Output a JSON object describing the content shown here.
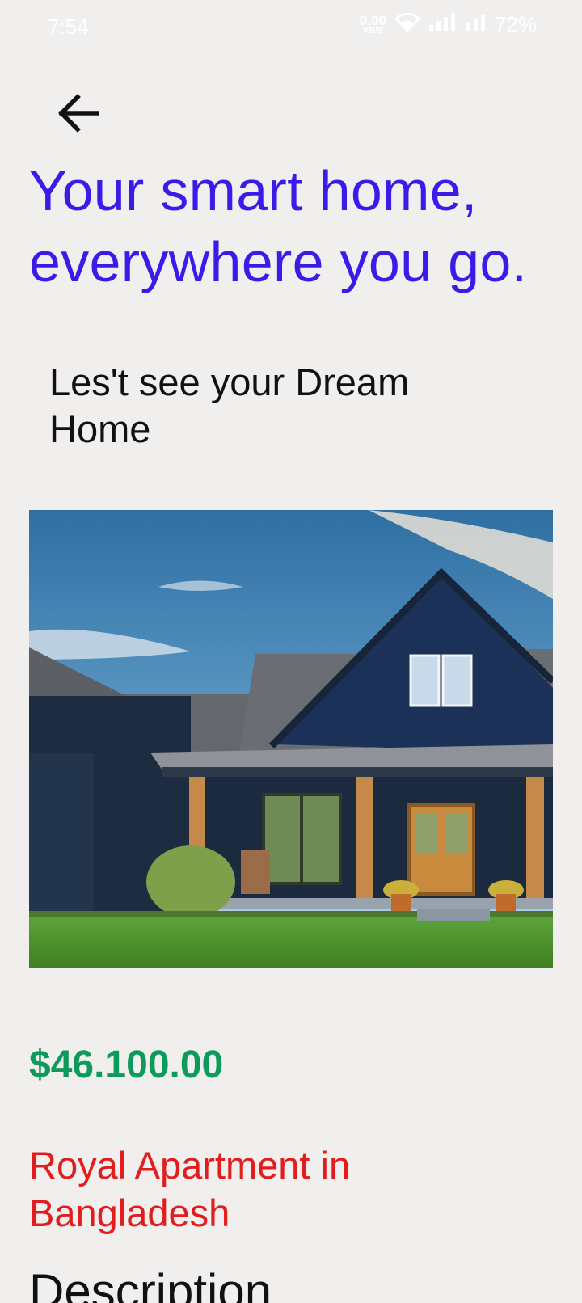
{
  "status_bar": {
    "time": "7:54",
    "net_speed_value": "0.00",
    "net_speed_unit": "KB/S",
    "battery": "72%",
    "icons": [
      "wifi-icon",
      "signal-icon",
      "signal-icon",
      "battery-indicator"
    ]
  },
  "nav": {
    "back_icon": "arrow-left-icon"
  },
  "header": {
    "headline": "Your smart home, everywhere you go.",
    "subtitle": "Les't see your Dream Home"
  },
  "property": {
    "image_alt": "house-photo",
    "price": "$46.100.00",
    "name": "Royal Apartment in Bangladesh",
    "description_title": "Description"
  },
  "colors": {
    "headline": "#3a1be8",
    "price": "#0e9a5a",
    "name": "#e11d1d",
    "background": "#f1eeee"
  }
}
